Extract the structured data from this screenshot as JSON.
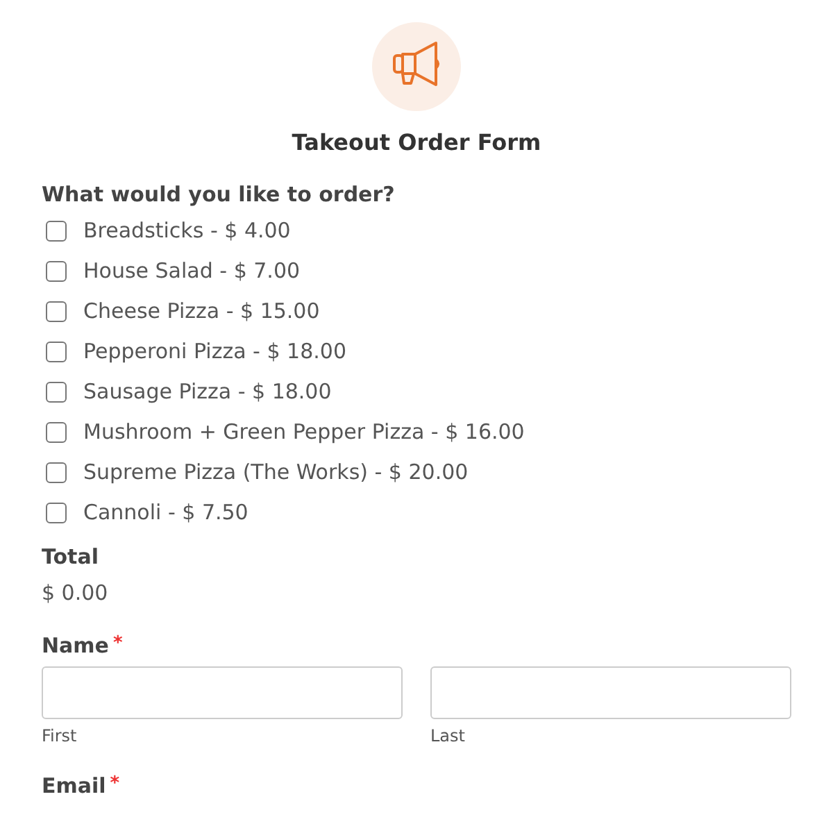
{
  "form": {
    "title": "Takeout Order Form"
  },
  "order": {
    "label": "What would you like to order?",
    "items": [
      {
        "label": "Breadsticks - $ 4.00",
        "checked": false
      },
      {
        "label": "House Salad - $ 7.00",
        "checked": false
      },
      {
        "label": "Cheese Pizza - $ 15.00",
        "checked": false
      },
      {
        "label": "Pepperoni Pizza - $ 18.00",
        "checked": false
      },
      {
        "label": "Sausage Pizza - $ 18.00",
        "checked": false
      },
      {
        "label": "Mushroom + Green Pepper Pizza - $ 16.00",
        "checked": false
      },
      {
        "label": "Supreme Pizza (The Works) - $ 20.00",
        "checked": false
      },
      {
        "label": "Cannoli - $ 7.50",
        "checked": false
      }
    ]
  },
  "total": {
    "label": "Total",
    "value": "$ 0.00"
  },
  "name": {
    "label": "Name",
    "required_mark": "*",
    "fields": [
      {
        "sublabel": "First"
      },
      {
        "sublabel": "Last"
      }
    ]
  },
  "email": {
    "label": "Email",
    "required_mark": "*"
  }
}
